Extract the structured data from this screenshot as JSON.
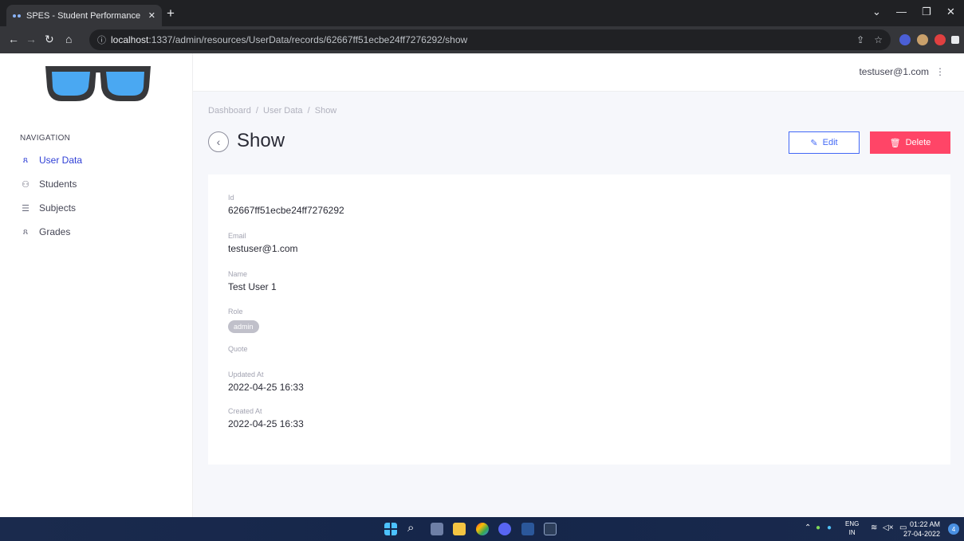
{
  "browser": {
    "tab_title": "SPES - Student Performance Evalu",
    "tab_close": "✕",
    "new_tab": "+",
    "url_host": "localhost",
    "url_path": ":1337/admin/resources/UserData/records/62667ff51ecbe24ff7276292/show",
    "info_icon": "ⓘ"
  },
  "sidebar": {
    "nav_heading": "NAVIGATION",
    "items": [
      {
        "label": "User Data",
        "icon": "people-icon",
        "active": true
      },
      {
        "label": "Students",
        "icon": "student-icon",
        "active": false
      },
      {
        "label": "Subjects",
        "icon": "list-icon",
        "active": false
      },
      {
        "label": "Grades",
        "icon": "people-icon",
        "active": false
      }
    ]
  },
  "topbar": {
    "user_email": "testuser@1.com"
  },
  "page": {
    "breadcrumb": [
      "Dashboard",
      "User Data",
      "Show"
    ],
    "breadcrumb_sep": "/",
    "title": "Show",
    "edit_label": "Edit",
    "delete_label": "Delete"
  },
  "record": {
    "fields": [
      {
        "label": "Id",
        "value": "62667ff51ecbe24ff7276292"
      },
      {
        "label": "Email",
        "value": "testuser@1.com"
      },
      {
        "label": "Name",
        "value": "Test User 1"
      },
      {
        "label": "Role",
        "value": "admin"
      },
      {
        "label": "Quote",
        "value": ""
      },
      {
        "label": "Updated At",
        "value": "2022-04-25 16:33"
      },
      {
        "label": "Created At",
        "value": "2022-04-25 16:33"
      }
    ]
  },
  "taskbar": {
    "lang_top": "ENG",
    "lang_bottom": "IN",
    "time": "01:22 AM",
    "date": "27-04-2022",
    "notifications": "4"
  },
  "colors": {
    "accent": "#3040d6",
    "primary": "#4268f6",
    "danger": "#ff4567",
    "logo_frame": "#37383b",
    "logo_lens": "#4aa8f2"
  }
}
